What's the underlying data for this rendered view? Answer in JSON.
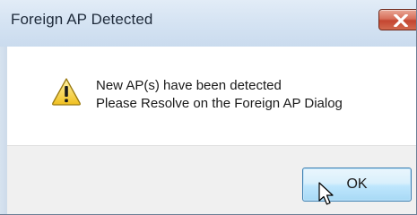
{
  "window": {
    "title": "Foreign AP Detected",
    "close_icon": "close-icon"
  },
  "message": {
    "icon": "warning-icon",
    "line1": "New AP(s) have been detected",
    "line2": "Please Resolve on the Foreign AP Dialog"
  },
  "buttons": {
    "ok_label": "OK"
  },
  "colors": {
    "close_button": "#c7432e",
    "ok_button_hover": "#bee6fd",
    "footer_bg": "#f0f0f0",
    "warning_fill": "#f7d33b"
  }
}
